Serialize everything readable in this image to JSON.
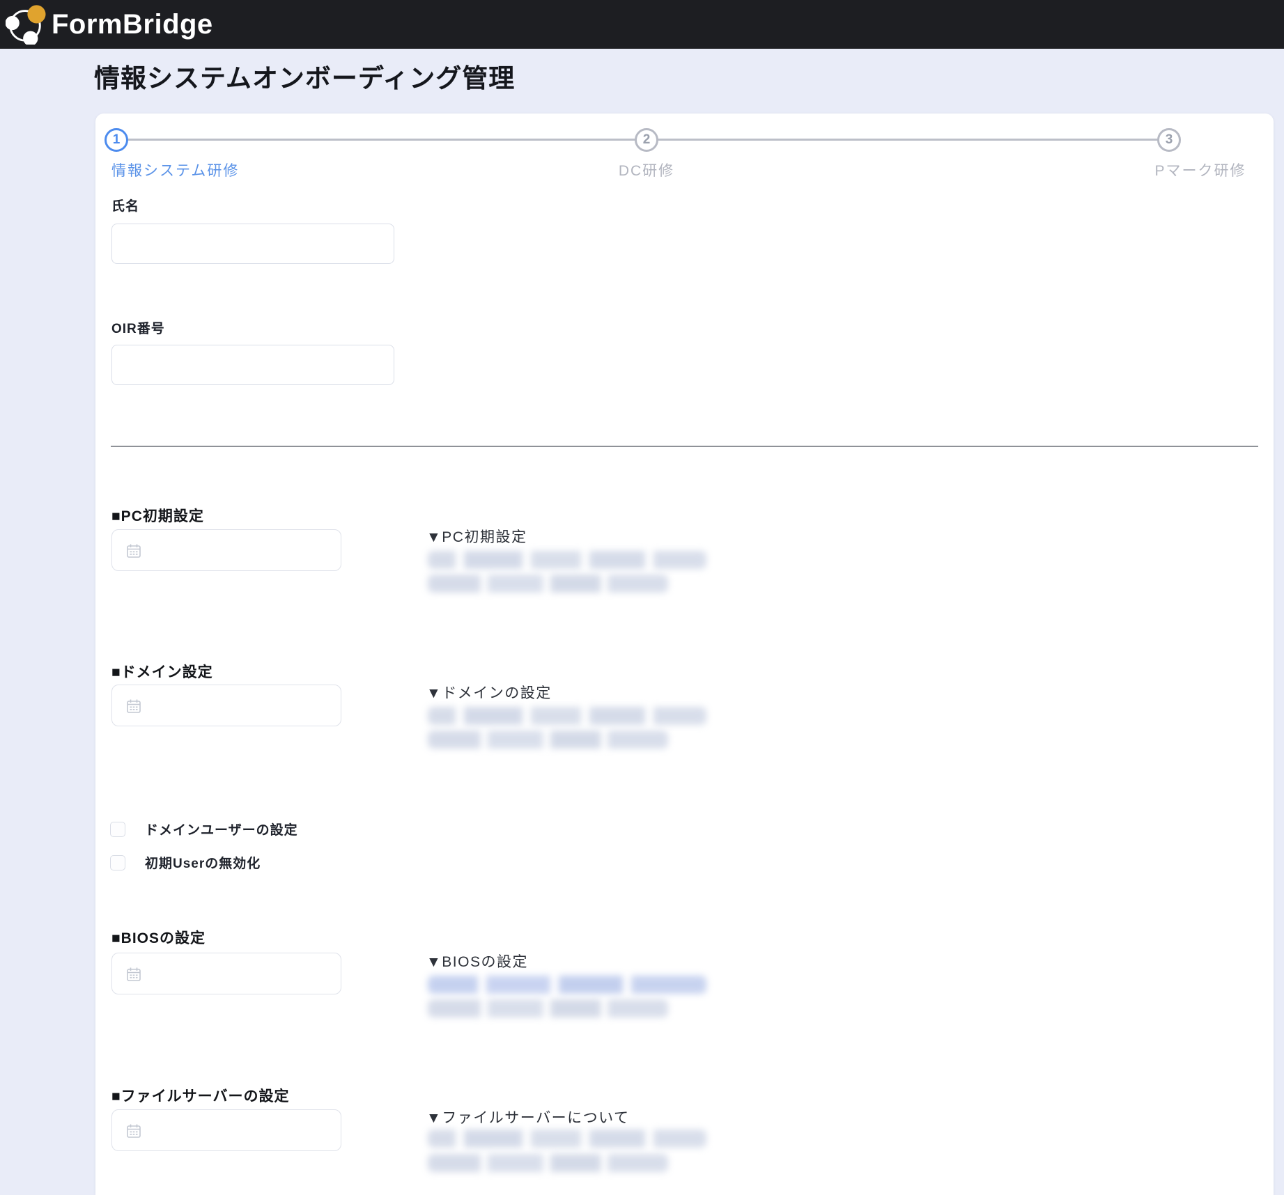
{
  "header": {
    "brand": "FormBridge"
  },
  "page": {
    "title": "情報システムオンボーディング管理"
  },
  "stepper": {
    "steps": [
      {
        "number": "1",
        "label": "情報システム研修",
        "state": "active"
      },
      {
        "number": "2",
        "label": "DC研修",
        "state": "inactive"
      },
      {
        "number": "3",
        "label": "Pマーク研修",
        "state": "inactive"
      }
    ]
  },
  "form": {
    "fields": [
      {
        "label": "氏名",
        "value": "",
        "type": "text"
      },
      {
        "label": "OIR番号",
        "value": "",
        "type": "text"
      }
    ],
    "sections": [
      {
        "heading": "■PC初期設定",
        "date_value": "",
        "info_heading": "▼PC初期設定",
        "blurred_lines": 2
      },
      {
        "heading": "■ドメイン設定",
        "date_value": "",
        "info_heading": "▼ドメインの設定",
        "blurred_lines": 2
      },
      {
        "heading": "■BIOSの設定",
        "date_value": "",
        "info_heading": "▼BIOSの設定",
        "blurred_lines": 2
      },
      {
        "heading": "■ファイルサーバーの設定",
        "date_value": "",
        "info_heading": "▼ファイルサーバーについて",
        "blurred_lines": 2
      }
    ],
    "checkboxes": [
      {
        "label": "ドメインユーザーの設定",
        "checked": false
      },
      {
        "label": "初期Userの無効化",
        "checked": false
      }
    ]
  },
  "colors": {
    "header_bg": "#1d1e22",
    "page_bg": "#e9ecf8",
    "card_bg": "#ffffff",
    "step_active": "#4c8bee",
    "step_inactive": "#b7bac4",
    "logo_accent": "#e0a32e"
  },
  "icons": {
    "logo": "formbridge-logo-icon",
    "date_field": "calendar-icon"
  }
}
